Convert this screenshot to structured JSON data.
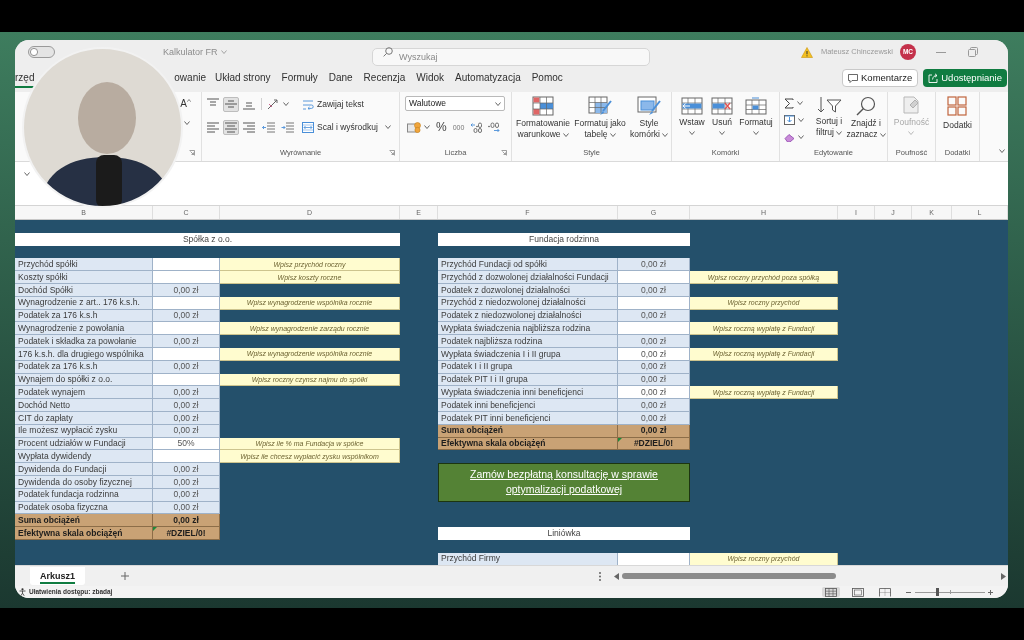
{
  "title_bar": {
    "autosave_on": false,
    "file_name": "Kalkulator FR",
    "search_placeholder": "Wyszukaj",
    "user_name": "Mateusz Chinczewski",
    "user_initials": "MC"
  },
  "ribbon_tabs": [
    {
      "label": "rzęd",
      "selected": true
    },
    {
      "label": "owanie",
      "selected": false
    },
    {
      "label": "Układ strony",
      "selected": false
    },
    {
      "label": "Formuły",
      "selected": false
    },
    {
      "label": "Dane",
      "selected": false
    },
    {
      "label": "Recenzja",
      "selected": false
    },
    {
      "label": "Widok",
      "selected": false
    },
    {
      "label": "Automatyzacja",
      "selected": false
    },
    {
      "label": "Pomoc",
      "selected": false
    }
  ],
  "ribbon_buttons": {
    "comments": "Komentarze",
    "share": "Udostępnianie"
  },
  "ribbon": {
    "font": {
      "grow_font": "A"
    },
    "alignment": {
      "vertical": [
        {
          "kind": "top",
          "selected": false
        },
        {
          "kind": "middle",
          "selected": true
        },
        {
          "kind": "bottom",
          "selected": false
        }
      ],
      "horizontal": [
        {
          "kind": "left",
          "selected": false
        },
        {
          "kind": "center",
          "selected": true
        },
        {
          "kind": "right",
          "selected": false
        }
      ],
      "wrap_text": "Zawijaj tekst",
      "merge": "Scal i wyśrodkuj",
      "label": "Wyrównanie"
    },
    "number": {
      "format": "Walutowe",
      "percent": "%",
      "thousands": "000",
      "label": "Liczba"
    },
    "styles": {
      "buttons": [
        {
          "kind": "conditional",
          "label": "Formatowanie warunkowe"
        },
        {
          "kind": "table",
          "label": "Formatuj jako tabelę"
        },
        {
          "kind": "cell",
          "label": "Style komórki"
        }
      ],
      "label": "Style"
    },
    "cells": {
      "buttons": [
        {
          "kind": "insert",
          "label": "Wstaw"
        },
        {
          "kind": "delete",
          "label": "Usuń"
        },
        {
          "kind": "format",
          "label": "Formatuj"
        }
      ],
      "label": "Komórki"
    },
    "editing": {
      "buttons": [
        {
          "kind": "sort",
          "label": "Sortuj i filtruj"
        },
        {
          "kind": "find",
          "label": "Znajdź i zaznacz"
        }
      ],
      "label": "Edytowanie"
    },
    "sensitivity": {
      "button": "Poufność",
      "disabled": true,
      "label": "Poufność"
    },
    "addins": {
      "button": "Dodatki",
      "label": "Dodatki"
    }
  },
  "column_headers": [
    "B",
    "C",
    "D",
    "E",
    "F",
    "G",
    "H",
    "I",
    "J",
    "K",
    "L"
  ],
  "company_block": {
    "title": "Spółka z o.o.",
    "rows": [
      {
        "label": "Przychód spółki",
        "kind": "input",
        "hint": "Wpisz przychód roczny",
        "error_flag": false
      },
      {
        "label": "Koszty spółki",
        "kind": "input",
        "hint": "Wpisz koszty roczne",
        "error_flag": false
      },
      {
        "label": "Dochód Spółki",
        "kind": "calc",
        "value": "0,00 zł",
        "error_flag": false
      },
      {
        "label": "Wynagrodzenie z art.. 176 k.s.h.",
        "kind": "input",
        "hint": "Wpisz wynagrodzenie wspólnika rocznie",
        "error_flag": false
      },
      {
        "label": "Podatek za 176 k.s.h",
        "kind": "calc",
        "value": "0,00 zł",
        "error_flag": false
      },
      {
        "label": "Wynagrodzenie z powołania",
        "kind": "input",
        "hint": "Wpisz wynagrodzenie zarządu rocznie",
        "error_flag": false
      },
      {
        "label": "Podatek i składka za powołanie",
        "kind": "calc",
        "value": "0,00 zł",
        "error_flag": false
      },
      {
        "label": "176 k.s.h. dla drugiego wspólnika",
        "kind": "input",
        "hint": "Wpisz wynagrodzenie wspólnika rocznie",
        "error_flag": false
      },
      {
        "label": "Podatek za 176 k.s.h",
        "kind": "calc",
        "value": "0,00 zł",
        "error_flag": false
      },
      {
        "label": "Wynajem do spółki z o.o.",
        "kind": "input",
        "hint": "Wpisz roczny czynsz najmu do spółki",
        "error_flag": false
      },
      {
        "label": "Podatek wynajem",
        "kind": "calc",
        "value": "0,00 zł",
        "error_flag": false
      },
      {
        "label": "Dochód Netto",
        "kind": "calc",
        "value": "0,00 zł",
        "error_flag": false
      },
      {
        "label": "CIT do zapłaty",
        "kind": "calc",
        "value": "0,00 zł",
        "error_flag": false
      },
      {
        "label": "Ile możesz wypłacić zysku",
        "kind": "calc",
        "value": "0,00 zł",
        "error_flag": false
      },
      {
        "label": "Procent udziałów w Fundacji",
        "kind": "input",
        "value": "50%",
        "hint": "Wpisz ile % ma Fundacja w spółce",
        "error_flag": false
      },
      {
        "label": "Wypłata dywidendy",
        "kind": "input",
        "hint": "Wpisz ile chcesz wypłacić zysku wspólnikom",
        "error_flag": false
      },
      {
        "label": "Dywidenda do Fundacji",
        "kind": "calc",
        "value": "0,00 zł",
        "error_flag": false
      },
      {
        "label": "Dywidenda do osoby fizycznej",
        "kind": "calc",
        "value": "0,00 zł",
        "error_flag": false
      },
      {
        "label": "Podatek fundacja rodzinna",
        "kind": "calc",
        "value": "0,00 zł",
        "error_flag": false
      },
      {
        "label": "Podatek osoba fizyczna",
        "kind": "calc",
        "value": "0,00 zł",
        "error_flag": false
      },
      {
        "label": "Suma obciążeń",
        "kind": "total",
        "value": "0,00 zł",
        "error_flag": false
      },
      {
        "label": "Efektywna skala obciążęń",
        "kind": "total",
        "value": "#DZIEL/0!",
        "error_flag": true
      }
    ]
  },
  "foundation_block": {
    "title": "Fundacja rodzinna",
    "rows": [
      {
        "label": "Przychód Fundacji od spółki",
        "kind": "calc",
        "value": "0,00 zł",
        "error_flag": false
      },
      {
        "label": "Przychód z dozwolonej działalności Fundacji",
        "kind": "input",
        "hint": "Wpisz roczny przychód poza spółką",
        "error_flag": false
      },
      {
        "label": "Podatek z dozwolonej działalności",
        "kind": "calc",
        "value": "0,00 zł",
        "error_flag": false
      },
      {
        "label": "Przychód z niedozwolonej działalności",
        "kind": "input",
        "hint": "Wpisz roczny przychód",
        "error_flag": false
      },
      {
        "label": "Podatek z niedozwolonej działalności",
        "kind": "calc",
        "value": "0,00 zł",
        "error_flag": false
      },
      {
        "label": "Wypłata świadczenia najbliższa rodzina",
        "kind": "input",
        "hint": "Wpisz roczną wypłatę z Fundacji",
        "error_flag": false
      },
      {
        "label": "Podatek najbliższa rodzina",
        "kind": "calc",
        "value": "0,00 zł",
        "error_flag": false
      },
      {
        "label": "Wypłata świadczenia I i II grupa",
        "kind": "input",
        "value": "0,00 zł",
        "hint": "Wpisz roczną wypłatę z Fundacji",
        "error_flag": false
      },
      {
        "label": "Podatek I i II grupa",
        "kind": "calc",
        "value": "0,00 zł",
        "error_flag": false
      },
      {
        "label": "Podatek PIT I i II grupa",
        "kind": "calc",
        "value": "0,00 zł",
        "error_flag": false
      },
      {
        "label": "Wypłata świadczenia inni beneficjenci",
        "kind": "input",
        "value": "0,00 zł",
        "hint": "Wpisz roczną wypłatę z Fundacji",
        "error_flag": false
      },
      {
        "label": "Podatek inni beneficjenci",
        "kind": "calc",
        "value": "0,00 zł",
        "error_flag": false
      },
      {
        "label": "Podatek PIT inni beneficjenci",
        "kind": "calc",
        "value": "0,00 zł",
        "error_flag": false
      },
      {
        "label": "Suma obciążeń",
        "kind": "total",
        "value": "0,00 zł",
        "error_flag": false
      },
      {
        "label": "Efektywna skala obciążęń",
        "kind": "total",
        "value": "#DZIEL/0!",
        "error_flag": true
      }
    ]
  },
  "consultation_link": "Zamów bezpłatną konsultację w sprawie optymalizacji podatkowej",
  "linear_tax_block": {
    "title": "Liniówka",
    "rows": [
      {
        "label": "Przychód Firmy",
        "kind": "input",
        "hint": "Wpisz roczny przychód",
        "error_flag": false
      }
    ]
  },
  "sheet_tabs": [
    {
      "label": "Arkusz1",
      "selected": true
    }
  ],
  "status_bar": {
    "accessibility": "Ułatwienia dostępu: zbadaj",
    "views": [
      {
        "kind": "normal",
        "selected": true
      },
      {
        "kind": "page_layout",
        "selected": false
      },
      {
        "kind": "page_break",
        "selected": false
      }
    ],
    "zoom": {
      "level": 0.31
    }
  },
  "webcam_overlay": {
    "visible": true
  }
}
